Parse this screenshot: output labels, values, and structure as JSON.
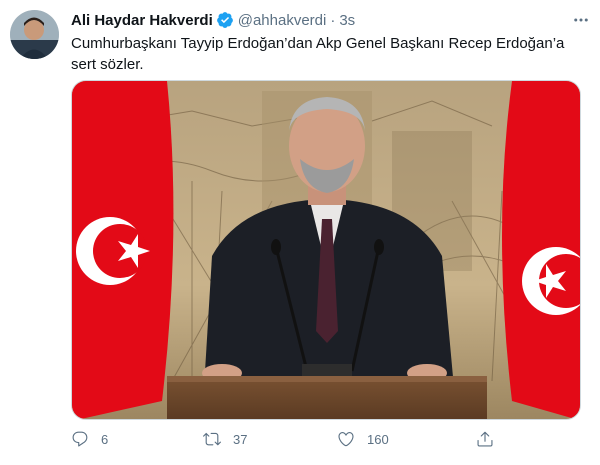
{
  "tweet": {
    "author_name": "Ali Haydar Hakverdi",
    "handle": "@ahhakverdi",
    "separator": "·",
    "time": "3s",
    "text": "Cumhurbaşkanı Tayyip Erdoğan’dan Akp Genel Başkanı Recep Erdoğan’a sert sözler.",
    "verified_icon": "verified-badge-icon",
    "more_icon": "more-options-icon"
  },
  "media": {
    "kind": "video-frame",
    "description_icon": "video-thumbnail"
  },
  "actions": {
    "reply": {
      "icon": "reply-icon",
      "count": "6"
    },
    "retweet": {
      "icon": "retweet-icon",
      "count": "37"
    },
    "like": {
      "icon": "like-icon",
      "count": "160"
    },
    "share": {
      "icon": "share-icon"
    }
  },
  "colors": {
    "verified": "#1da1f2",
    "secondary_text": "#5b7083",
    "flag_red": "#e30a17"
  }
}
